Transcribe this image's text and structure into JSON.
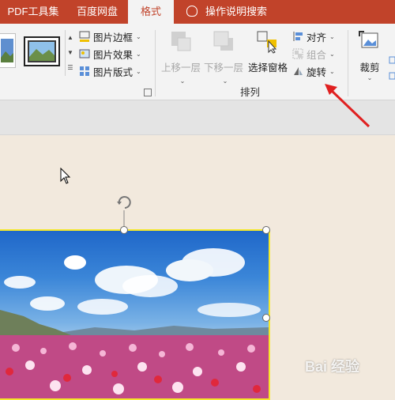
{
  "tabs": [
    {
      "label": "PDF工具集",
      "active": false
    },
    {
      "label": "百度网盘",
      "active": false
    },
    {
      "label": "格式",
      "active": true
    }
  ],
  "tell_me": "操作说明搜索",
  "picture_styles": {
    "border_label": "图片边框",
    "effects_label": "图片效果",
    "layout_label": "图片版式"
  },
  "arrange": {
    "bring_forward": "上移一层",
    "send_backward": "下移一层",
    "selection_pane": "选择窗格",
    "align": "对齐",
    "group": "组合",
    "rotate": "旋转",
    "group_label": "排列"
  },
  "crop_label": "裁剪",
  "watermark": "Bai 经验",
  "colors": {
    "tab_bar": "#c1432a",
    "ribbon": "#f3f3f3",
    "canvas": "#f2e9dd",
    "selection": "#f5e72a",
    "arrow": "#e02020"
  }
}
